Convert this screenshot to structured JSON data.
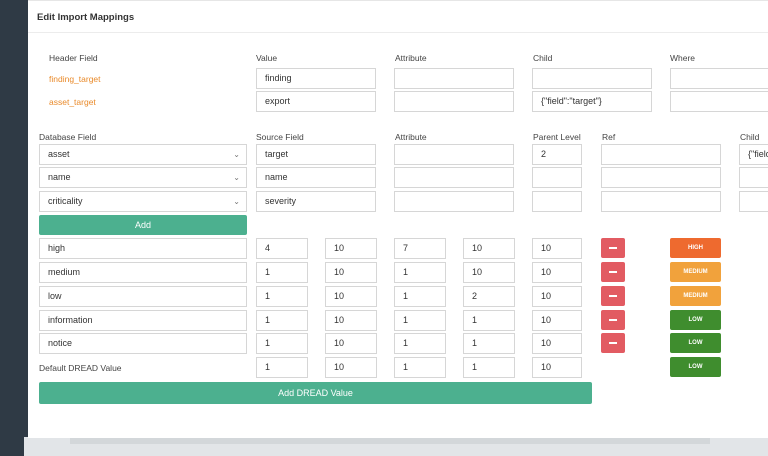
{
  "title": "Edit Import Mappings",
  "header_columns": [
    "Header Field",
    "Value",
    "Attribute",
    "Child",
    "Where"
  ],
  "header_rows": [
    {
      "field": "finding_target",
      "value": "finding",
      "attribute": "",
      "child": "",
      "where": ""
    },
    {
      "field": "asset_target",
      "value": "export",
      "attribute": "",
      "child": "{\"field\":\"target\"}",
      "where": ""
    }
  ],
  "db_columns": [
    "Database Field",
    "Source Field",
    "Attribute",
    "Parent Level",
    "Ref",
    "Child"
  ],
  "db_rows": [
    {
      "db_field": "asset",
      "source": "target",
      "attribute": "",
      "parent_level": "2",
      "ref": "",
      "child": "{\"field"
    },
    {
      "db_field": "name",
      "source": "name",
      "attribute": "",
      "parent_level": "",
      "ref": "",
      "child": ""
    },
    {
      "db_field": "criticality",
      "source": "severity",
      "attribute": "",
      "parent_level": "",
      "ref": "",
      "child": ""
    }
  ],
  "add_label": "Add",
  "dread_rows": [
    {
      "name": "high",
      "v": [
        "4",
        "10",
        "7",
        "10",
        "10"
      ],
      "badge": "HIGH",
      "color": "#ee6a2f"
    },
    {
      "name": "medium",
      "v": [
        "1",
        "10",
        "1",
        "10",
        "10"
      ],
      "badge": "MEDIUM",
      "color": "#f1a23c"
    },
    {
      "name": "low",
      "v": [
        "1",
        "10",
        "1",
        "2",
        "10"
      ],
      "badge": "MEDIUM",
      "color": "#f1a23c"
    },
    {
      "name": "information",
      "v": [
        "1",
        "10",
        "1",
        "1",
        "10"
      ],
      "badge": "LOW",
      "color": "#3f8d2e"
    },
    {
      "name": "notice",
      "v": [
        "1",
        "10",
        "1",
        "1",
        "10"
      ],
      "badge": "LOW",
      "color": "#3f8d2e"
    }
  ],
  "default_dread": {
    "label": "Default DREAD Value",
    "v": [
      "1",
      "10",
      "1",
      "1",
      "10"
    ],
    "badge": "LOW",
    "color": "#3f8d2e"
  },
  "add_dread_label": "Add DREAD Value"
}
